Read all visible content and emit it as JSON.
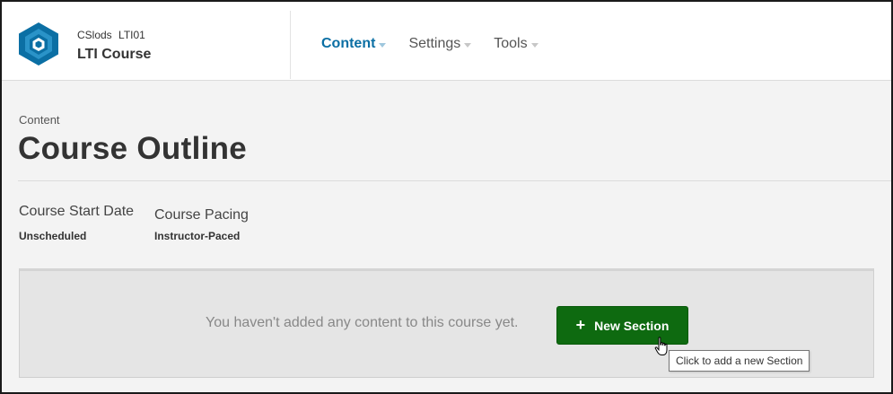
{
  "header": {
    "course_org": "CSlods",
    "course_number": "LTI01",
    "course_title": "LTI Course",
    "nav": [
      {
        "label": "Content",
        "active": true
      },
      {
        "label": "Settings",
        "active": false
      },
      {
        "label": "Tools",
        "active": false
      }
    ]
  },
  "page": {
    "breadcrumb": "Content",
    "title": "Course Outline"
  },
  "settings": {
    "start_date": {
      "label": "Course Start Date",
      "value": "Unscheduled"
    },
    "pacing": {
      "label": "Course Pacing",
      "value": "Instructor-Paced"
    }
  },
  "outline": {
    "empty_message": "You haven't added any content to this course yet.",
    "new_section_label": "New Section",
    "new_section_tooltip": "Click to add a new Section"
  },
  "colors": {
    "brand": "#0b6fa4",
    "button": "#0e6a10"
  },
  "icons": {
    "logo": "hexagon-logo-icon",
    "nav_caret": "caret-down-icon",
    "add": "plus-icon",
    "pointer": "hand-pointer-icon"
  }
}
